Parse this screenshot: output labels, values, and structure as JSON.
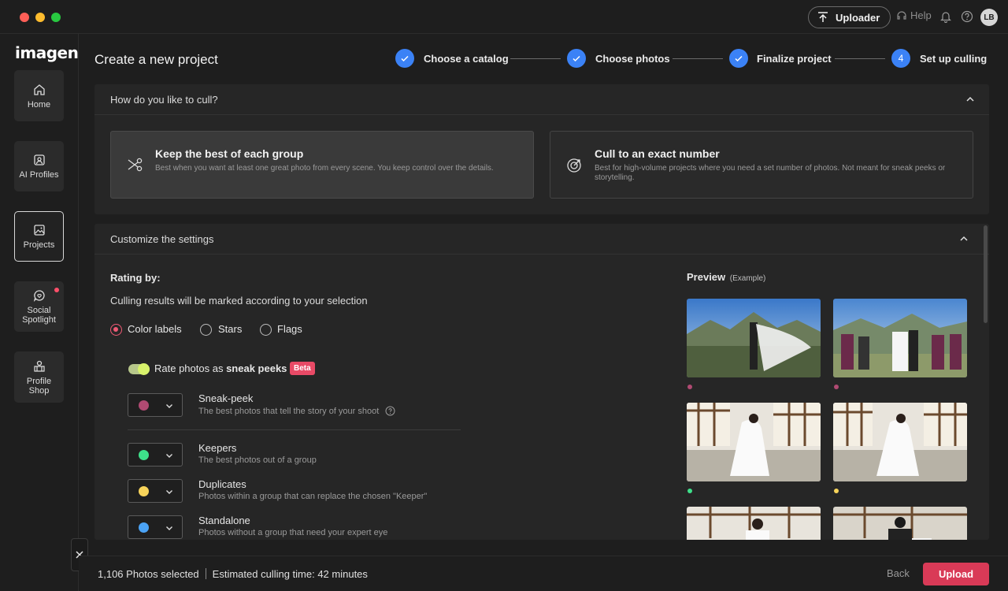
{
  "titlebar": {
    "uploader_label": "Uploader",
    "help_label": "Help",
    "avatar_initials": "LB"
  },
  "sidebar": {
    "logo": "imagen",
    "items": [
      {
        "label": "Home",
        "icon": "home-icon"
      },
      {
        "label": "AI Profiles",
        "icon": "ai-profile-icon"
      },
      {
        "label": "Projects",
        "icon": "projects-icon"
      },
      {
        "label": "Social Spotlight",
        "icon": "social-spotlight-icon"
      },
      {
        "label": "Profile Shop",
        "icon": "profile-shop-icon"
      }
    ]
  },
  "header": {
    "title": "Create a new project",
    "steps": [
      {
        "label": "Choose a catalog",
        "state": "done"
      },
      {
        "label": "Choose photos",
        "state": "done"
      },
      {
        "label": "Finalize project",
        "state": "done"
      },
      {
        "label": "Set up culling",
        "state": "current",
        "number": "4"
      }
    ]
  },
  "cull_panel": {
    "heading": "How do you like to cull?",
    "options": [
      {
        "title": "Keep the best of each group",
        "desc": "Best when you want at least one great photo from every scene. You keep control over the details.",
        "selected": true,
        "icon": "scissors-icon"
      },
      {
        "title": "Cull to an exact number",
        "desc": "Best for high-volume projects where you need a set number of photos. Not meant for sneak peeks or storytelling.",
        "selected": false,
        "icon": "target-icon"
      }
    ]
  },
  "settings": {
    "heading": "Customize the settings",
    "rating_by": "Rating by:",
    "rating_desc": "Culling results will be marked according to your selection",
    "rating_options": [
      "Color labels",
      "Stars",
      "Flags"
    ],
    "rating_selected": "Color labels",
    "sneak_toggle_prefix": "Rate photos as",
    "sneak_toggle_bold": "sneak peeks",
    "beta": "Beta",
    "rows": [
      {
        "title": "Sneak-peek",
        "desc": "The best photos that tell the story of your shoot",
        "color": "#b04a72"
      },
      {
        "title": "Keepers",
        "desc": "The best photos out of a group",
        "color": "#3ee08a"
      },
      {
        "title": "Duplicates",
        "desc": "Photos within a group that can replace the chosen \"Keeper\"",
        "color": "#f7d35a"
      },
      {
        "title": "Standalone",
        "desc": "Photos without a group that need your expert eye",
        "color": "#4ba3f5"
      }
    ],
    "preview_label": "Preview",
    "preview_sub": "(Example)"
  },
  "footer": {
    "photos_selected": "1,106 Photos selected",
    "estimate": "Estimated culling time: 42 minutes",
    "back": "Back",
    "upload": "Upload"
  },
  "colors": {
    "accent_blue": "#3b82f6",
    "upload_red": "#d93a57",
    "radio_pink": "#f05a75"
  }
}
